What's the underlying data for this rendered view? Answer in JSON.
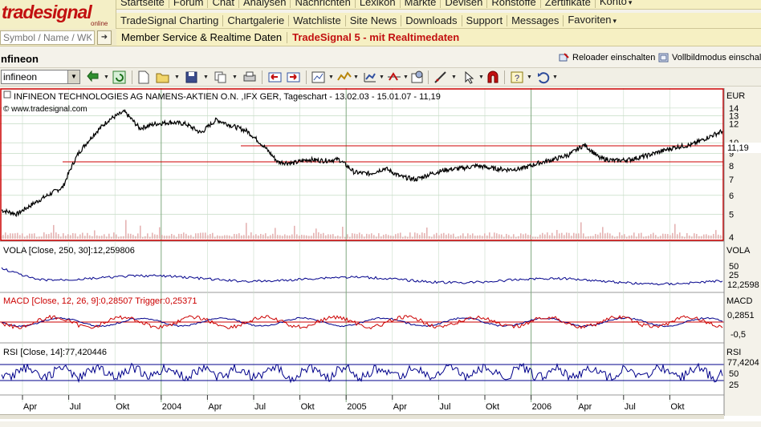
{
  "logo": {
    "text": "tradesignal",
    "sub": "online"
  },
  "nav_top": [
    "Startseite",
    "Forum",
    "Chat",
    "Analysen",
    "Nachrichten",
    "Lexikon",
    "Märkte",
    "Devisen",
    "Rohstoffe",
    "Zertifikate",
    "Konto"
  ],
  "nav_main": [
    "TradeSignal Charting",
    "Chartgalerie",
    "Watchliste",
    "Site News",
    "Downloads",
    "Support",
    "Messages",
    "Favoriten"
  ],
  "symbol_input": {
    "placeholder": "Symbol / Name / WKN"
  },
  "nav_sub": {
    "member": "Member Service & Realtime Daten",
    "promo": "TradeSignal 5 - mit Realtimedaten"
  },
  "instrument": {
    "title": "nfineon",
    "reload_label": "Reloader einschalten",
    "fullscreen_label": "Vollbildmodus einschalten",
    "combo_value": "infineon"
  },
  "panels": {
    "price": {
      "title": "INFINEON TECHNOLOGIES AG NAMENS-AKTIEN O.N. ,IFX GER, Tageschart - 13.02.03 - 15.01.07 - 11,19",
      "source": "© www.tradesignal.com",
      "unit": "EUR",
      "last_value": "11,19",
      "ticks": [
        "14",
        "13",
        "12",
        "10",
        "9",
        "8",
        "7",
        "6",
        "5",
        "4"
      ]
    },
    "vola": {
      "title": "VOLA [Close, 250, 30]:12,259806",
      "name": "VOLA",
      "last_value": "12,2598",
      "ticks": [
        "50",
        "25"
      ]
    },
    "macd": {
      "title": "MACD [Close, 12, 26, 9]:0,28507 Trigger:0,25371",
      "name": "MACD",
      "last_value": "0,2851",
      "ticks": [
        "-0,5"
      ]
    },
    "rsi": {
      "title": "RSI [Close, 14]:77,420446",
      "name": "RSI",
      "last_value": "77,4204",
      "ticks": [
        "50",
        "25"
      ]
    }
  },
  "time_axis": [
    "Apr",
    "Jul",
    "Okt",
    "2004",
    "Apr",
    "Jul",
    "Okt",
    "2005",
    "Apr",
    "Jul",
    "Okt",
    "2006",
    "Apr",
    "Jul",
    "Okt"
  ],
  "chart_data": {
    "type": "line",
    "title": "INFINEON TECHNOLOGIES AG NAMENS-AKTIEN O.N. ,IFX GER, Tageschart - 13.02.03 - 15.01.07 - 11,19",
    "ylabel": "EUR",
    "ylim": [
      4,
      15
    ],
    "y_scale": "log",
    "x": [
      "2003-02",
      "2003-03",
      "2003-04",
      "2003-05",
      "2003-06",
      "2003-07",
      "2003-08",
      "2003-09",
      "2003-10",
      "2003-11",
      "2003-12",
      "2004-01",
      "2004-02",
      "2004-03",
      "2004-04",
      "2004-05",
      "2004-06",
      "2004-07",
      "2004-08",
      "2004-09",
      "2004-10",
      "2004-11",
      "2004-12",
      "2005-01",
      "2005-02",
      "2005-03",
      "2005-04",
      "2005-05",
      "2005-06",
      "2005-07",
      "2005-08",
      "2005-09",
      "2005-10",
      "2005-11",
      "2005-12",
      "2006-01",
      "2006-02",
      "2006-03",
      "2006-04",
      "2006-05",
      "2006-06",
      "2006-07",
      "2006-08",
      "2006-09",
      "2006-10",
      "2006-11",
      "2006-12",
      "2007-01"
    ],
    "series": [
      {
        "values": [
          5.2,
          5.0,
          5.5,
          6.0,
          6.5,
          9.0,
          10.8,
          12.5,
          13.5,
          11.5,
          12.0,
          12.2,
          12.0,
          11.0,
          12.5,
          11.8,
          11.2,
          9.8,
          8.3,
          8.2,
          8.5,
          8.4,
          8.5,
          7.5,
          7.4,
          7.8,
          7.2,
          7.0,
          7.4,
          7.7,
          7.8,
          8.0,
          7.8,
          7.7,
          7.8,
          8.2,
          8.5,
          8.9,
          9.8,
          8.6,
          8.4,
          8.5,
          8.8,
          9.2,
          9.6,
          9.8,
          10.5,
          11.19
        ]
      }
    ],
    "horizontal_lines": [
      11.19,
      10.0
    ],
    "volume": "shown as pale red histogram at bottom of price panel",
    "indicators": {
      "VOLA": {
        "last": 12.259806,
        "ticks": [
          50,
          25
        ]
      },
      "MACD": {
        "last": 0.28507,
        "trigger": 0.25371,
        "ticks": [
          -0.5
        ]
      },
      "RSI": {
        "last": 77.420446,
        "ticks": [
          50,
          25
        ]
      }
    },
    "grid": true
  },
  "colors": {
    "brand_red": "#c21010",
    "nav_bg": "#f6f0c3",
    "price_line": "#000000",
    "frame_red": "#cc0000",
    "vola_line": "#00008b",
    "macd_line": "#cc0000",
    "rsi_line": "#00008b",
    "grid": "#9fc09f",
    "volume": "#e5b3b3"
  }
}
